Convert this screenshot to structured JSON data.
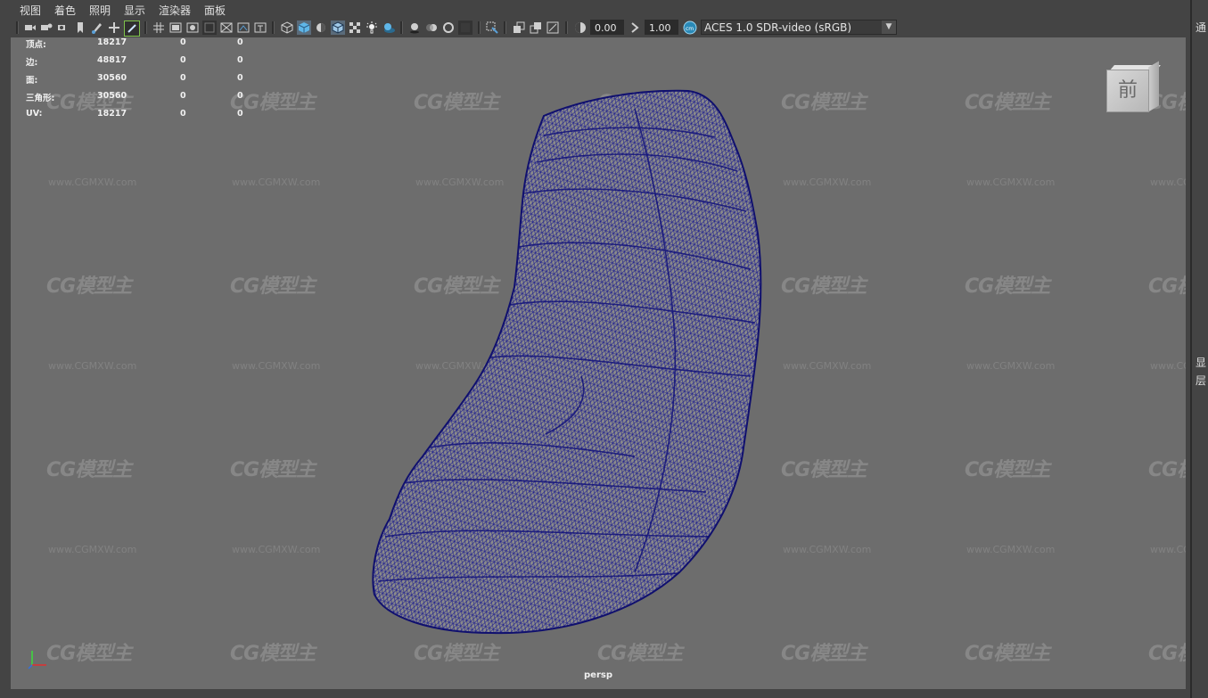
{
  "menu": [
    "视图",
    "着色",
    "照明",
    "显示",
    "渲染器",
    "面板"
  ],
  "toolbar": {
    "icons_group1": [
      "camera-icon",
      "camera-attr-icon",
      "bookmark-icon",
      "image-plane-icon",
      "grease-pencil-icon",
      "move-icon",
      "brush-icon"
    ],
    "icons_group2": [
      "grid-icon",
      "film-gate-icon",
      "resolution-gate-icon",
      "gate-mask-icon",
      "field-chart-icon",
      "safe-action-icon",
      "safe-title-icon"
    ],
    "icons_group3": [
      "wireframe-icon",
      "smooth-shade-icon",
      "default-material-icon",
      "wireframe-on-shaded-icon",
      "textured-icon",
      "use-all-lights-icon",
      "shadows-icon"
    ],
    "icons_group4": [
      "ambient-occlusion-icon",
      "motion-blur-icon",
      "anti-aliasing-icon",
      "depth-of-field-icon"
    ],
    "icons_group5": [
      "select-icon",
      "isolate-icon",
      "xray-icon",
      "xray-joints-icon",
      "backface-icon"
    ],
    "exposure_value": "0.00",
    "gamma_value": "1.00",
    "colorspace": "ACES 1.0 SDR-video (sRGB)"
  },
  "hud": {
    "rows": [
      {
        "label": "顶点:",
        "v1": "18217",
        "v2": "0",
        "v3": "0"
      },
      {
        "label": "边:",
        "v1": "48817",
        "v2": "0",
        "v3": "0"
      },
      {
        "label": "面:",
        "v1": "30560",
        "v2": "0",
        "v3": "0"
      },
      {
        "label": "三角形:",
        "v1": "30560",
        "v2": "0",
        "v3": "0"
      },
      {
        "label": "UV:",
        "v1": "18217",
        "v2": "0",
        "v3": "0"
      }
    ]
  },
  "viewcube": {
    "label": "前"
  },
  "camera_label": "persp",
  "watermark": {
    "logo": "CG模型主",
    "url": "www.CGMXW.com"
  },
  "right_panel": [
    "通",
    "显",
    "层"
  ],
  "colors": {
    "wire": "#1c1c8f",
    "mesh": "#8a8a8a",
    "viewport": "#6d6d6d",
    "ui": "#444444"
  }
}
